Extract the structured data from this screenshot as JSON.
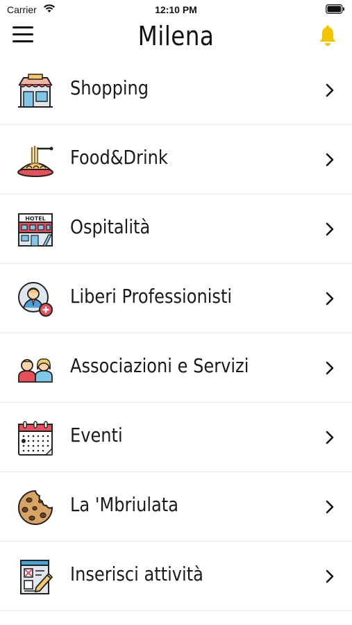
{
  "status_bar": {
    "carrier": "Carrier",
    "time": "12:10 PM",
    "wifi_icon": "wifi-icon",
    "battery_icon": "battery-icon"
  },
  "header": {
    "title": "Milena",
    "menu_icon": "hamburger-menu-icon",
    "notification_icon": "bell-icon",
    "notification_color": "#F5C400"
  },
  "menu": {
    "items": [
      {
        "label": "Shopping",
        "icon": "shop-icon"
      },
      {
        "label": "Food&Drink",
        "icon": "pasta-icon"
      },
      {
        "label": "Ospitalità",
        "icon": "hotel-icon"
      },
      {
        "label": "Liberi Professionisti",
        "icon": "professional-icon"
      },
      {
        "label": "Associazioni e Servizi",
        "icon": "people-icon"
      },
      {
        "label": "Eventi",
        "icon": "calendar-icon"
      },
      {
        "label": "La 'Mbriulata",
        "icon": "cookie-icon"
      },
      {
        "label": "Inserisci attività",
        "icon": "form-edit-icon"
      }
    ]
  }
}
